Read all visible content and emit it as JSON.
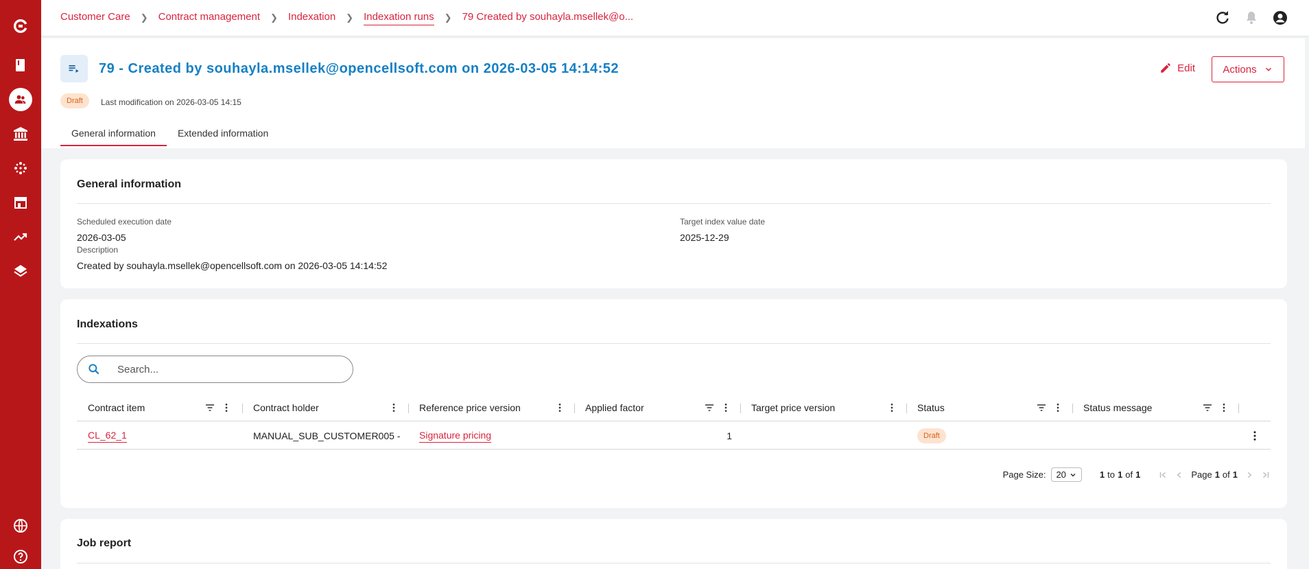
{
  "breadcrumb": [
    "Customer Care",
    "Contract management",
    "Indexation",
    "Indexation runs",
    "79 Created by souhayla.msellek@o..."
  ],
  "header": {
    "title": "79 - Created by souhayla.msellek@opencellsoft.com on 2026-03-05 14:14:52",
    "status": "Draft",
    "last_modification": "Last modification on 2026-03-05 14:15",
    "edit_label": "Edit",
    "actions_label": "Actions"
  },
  "tabs": [
    "General information",
    "Extended information"
  ],
  "general": {
    "title": "General information",
    "scheduled_label": "Scheduled execution date",
    "scheduled_value": "2026-03-05",
    "target_label": "Target index value date",
    "target_value": "2025-12-29",
    "description_label": "Description",
    "description_value": "Created by souhayla.msellek@opencellsoft.com on 2026-03-05 14:14:52"
  },
  "indexations": {
    "title": "Indexations",
    "search_placeholder": "Search...",
    "columns": [
      "Contract item",
      "Contract holder",
      "Reference price version",
      "Applied factor",
      "Target price version",
      "Status",
      "Status message"
    ],
    "rows": [
      {
        "contract_item": "CL_62_1",
        "contract_holder": "MANUAL_SUB_CUSTOMER005 -",
        "reference_price_version": "Signature pricing",
        "applied_factor": "1",
        "target_price_version": "",
        "status": "Draft",
        "status_message": ""
      }
    ],
    "pager": {
      "page_size_label": "Page Size:",
      "page_size_value": "20",
      "range_from": "1",
      "range_to_text": "to",
      "range_to": "1",
      "of_text": "of",
      "total": "1",
      "page_label": "Page",
      "page": "1",
      "page_of": "of",
      "page_total": "1"
    }
  },
  "job_report": {
    "title": "Job report"
  },
  "colors": {
    "primary_red": "#d8243d",
    "sidebar_red": "#b8171a",
    "title_blue": "#1680c4"
  },
  "icons": {
    "sidebar": [
      "logo-icon",
      "book-icon",
      "customer-care-icon",
      "bank-icon",
      "network-icon",
      "store-icon",
      "trend-icon",
      "layers-icon",
      "globe-icon",
      "help-icon"
    ],
    "topbar": [
      "refresh-icon",
      "bell-icon",
      "account-icon"
    ]
  }
}
